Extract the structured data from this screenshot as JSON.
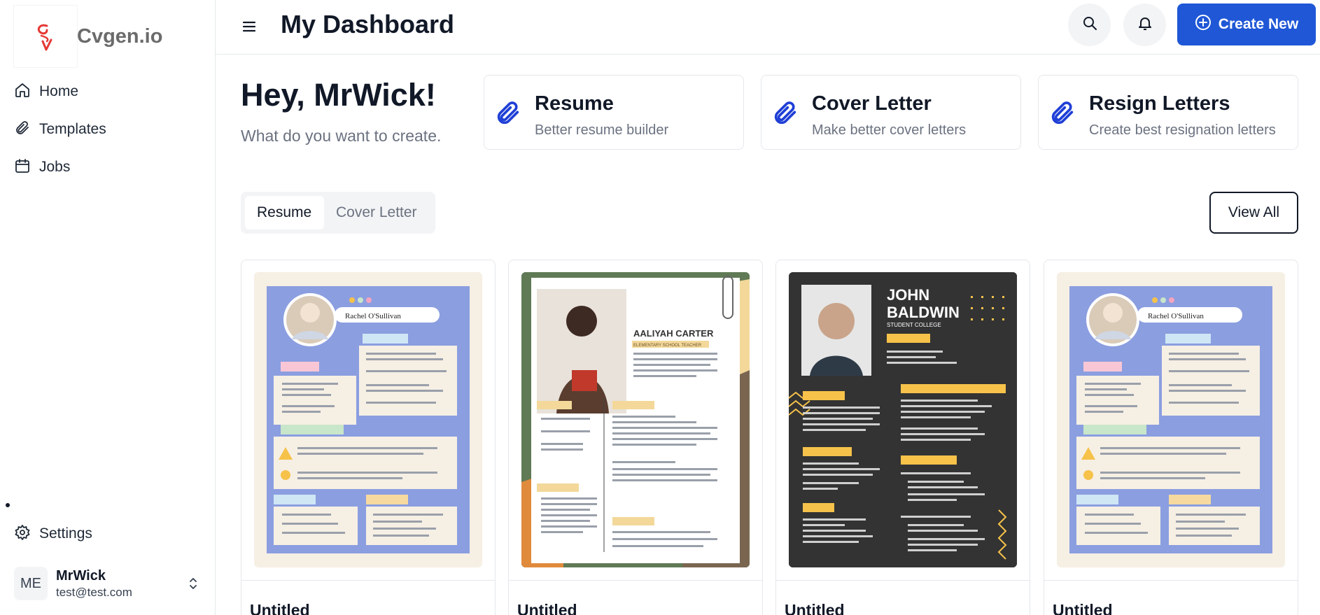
{
  "brand": {
    "name": "Cvgen.io",
    "logo_mark": "cv"
  },
  "sidebar": {
    "items": [
      {
        "label": "Home",
        "icon": "home-icon"
      },
      {
        "label": "Templates",
        "icon": "paperclip-icon"
      },
      {
        "label": "Jobs",
        "icon": "calendar-icon"
      }
    ],
    "settings_label": "Settings",
    "user": {
      "initials": "ME",
      "name": "MrWick",
      "email": "test@test.com"
    }
  },
  "header": {
    "title": "My Dashboard",
    "create_label": "Create New"
  },
  "main": {
    "greeting": "Hey, MrWick!",
    "subtitle": "What do you want to create.",
    "cards": [
      {
        "title": "Resume",
        "subtitle": "Better resume builder"
      },
      {
        "title": "Cover Letter",
        "subtitle": "Make better cover letters"
      },
      {
        "title": "Resign Letters",
        "subtitle": "Create best resignation letters"
      }
    ],
    "tabs": [
      {
        "label": "Resume",
        "active": true
      },
      {
        "label": "Cover Letter",
        "active": false
      }
    ],
    "view_all_label": "View All",
    "templates": [
      {
        "name": "Untitled",
        "person": "Rachel O'Sullivan"
      },
      {
        "name": "Untitled",
        "person": "AALIYAH CARTER",
        "role": "ELEMENTARY SCHOOL TEACHER"
      },
      {
        "name": "Untitled",
        "person_first": "JOHN",
        "person_last": "BALDWIN",
        "role": "STUDENT COLLEGE"
      },
      {
        "name": "Untitled",
        "person": "Rachel O'Sullivan"
      }
    ]
  },
  "colors": {
    "accent": "#1f57d6",
    "logo": "#e53935",
    "clip": "#1f3fd6"
  }
}
